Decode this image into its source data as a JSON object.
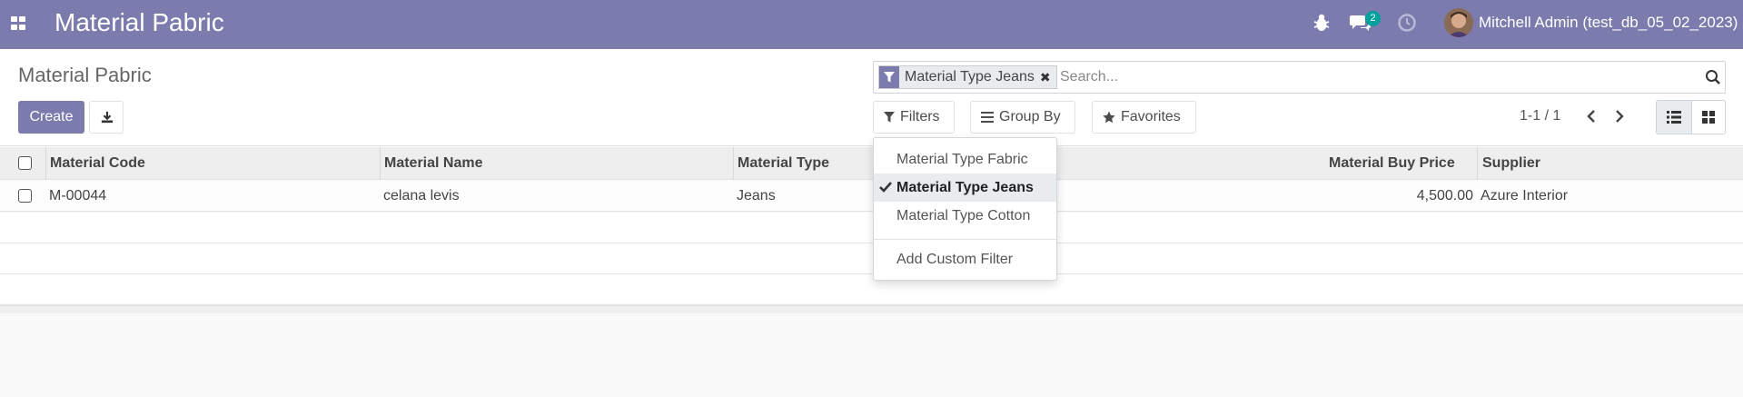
{
  "navbar": {
    "app_title": "Material Pabric",
    "chat_count": "2",
    "user": "Mitchell Admin (test_db_05_02_2023)",
    "color": "#7c7bad"
  },
  "control_panel": {
    "breadcrumb": "Material Pabric",
    "create_label": "Create",
    "search": {
      "facet": "Material Type Jeans",
      "placeholder": "Search..."
    },
    "filters_label": "Filters",
    "groupby_label": "Group By",
    "favorites_label": "Favorites",
    "pager": "1-1 / 1"
  },
  "table": {
    "columns": [
      "Material Code",
      "Material Name",
      "Material Type",
      "Material Buy Price",
      "Supplier"
    ],
    "rows": [
      {
        "code": "M-00044",
        "name": "celana levis",
        "type": "Jeans",
        "price": "4,500.00",
        "supplier": "Azure Interior"
      }
    ]
  },
  "filters_menu": {
    "items": [
      "Material Type Fabric",
      "Material Type Jeans",
      "Material Type Cotton"
    ],
    "selected": "Material Type Jeans",
    "custom": "Add Custom Filter"
  },
  "icons": [
    "apps-icon",
    "bug-icon",
    "chat-icon",
    "clock-icon",
    "download-icon",
    "filter-icon",
    "search-icon",
    "list-view-icon",
    "kanban-view-icon",
    "chevron-left-icon",
    "chevron-right-icon",
    "check-icon",
    "star-icon",
    "bars-icon"
  ]
}
